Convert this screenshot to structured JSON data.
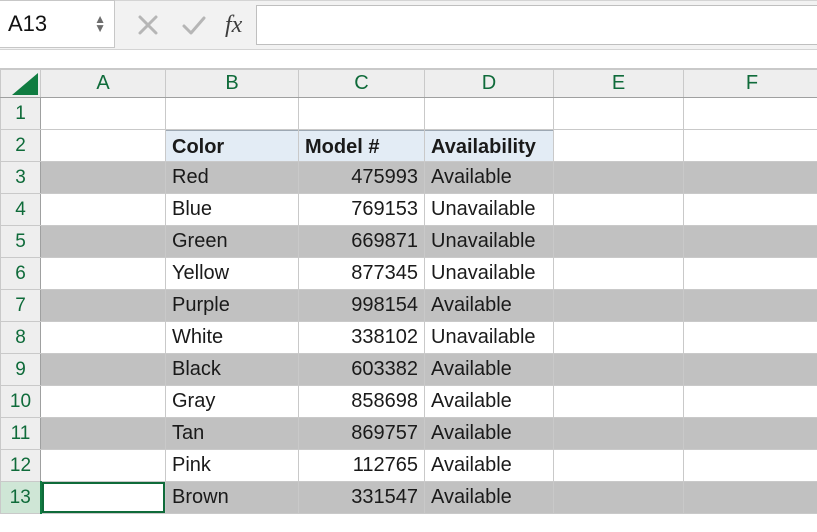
{
  "formula_bar": {
    "cell_ref": "A13",
    "fx_label": "fx",
    "formula_value": ""
  },
  "columns": [
    "A",
    "B",
    "C",
    "D",
    "E",
    "F"
  ],
  "row_numbers": [
    "1",
    "2",
    "3",
    "4",
    "5",
    "6",
    "7",
    "8",
    "9",
    "10",
    "11",
    "12",
    "13"
  ],
  "headers": {
    "b": "Color",
    "c": "Model #",
    "d": "Availability"
  },
  "rows": {
    "r3": {
      "color": "Red",
      "model": "475993",
      "avail": "Available"
    },
    "r4": {
      "color": "Blue",
      "model": "769153",
      "avail": "Unavailable"
    },
    "r5": {
      "color": "Green",
      "model": "669871",
      "avail": "Unavailable"
    },
    "r6": {
      "color": "Yellow",
      "model": "877345",
      "avail": "Unavailable"
    },
    "r7": {
      "color": "Purple",
      "model": "998154",
      "avail": "Available"
    },
    "r8": {
      "color": "White",
      "model": "338102",
      "avail": "Unavailable"
    },
    "r9": {
      "color": "Black",
      "model": "603382",
      "avail": "Available"
    },
    "r10": {
      "color": "Gray",
      "model": "858698",
      "avail": "Available"
    },
    "r11": {
      "color": "Tan",
      "model": "869757",
      "avail": "Available"
    },
    "r12": {
      "color": "Pink",
      "model": "112765",
      "avail": "Available"
    },
    "r13": {
      "color": "Brown",
      "model": "331547",
      "avail": "Available"
    }
  },
  "icons": {
    "up": "▲",
    "down": "▼"
  }
}
